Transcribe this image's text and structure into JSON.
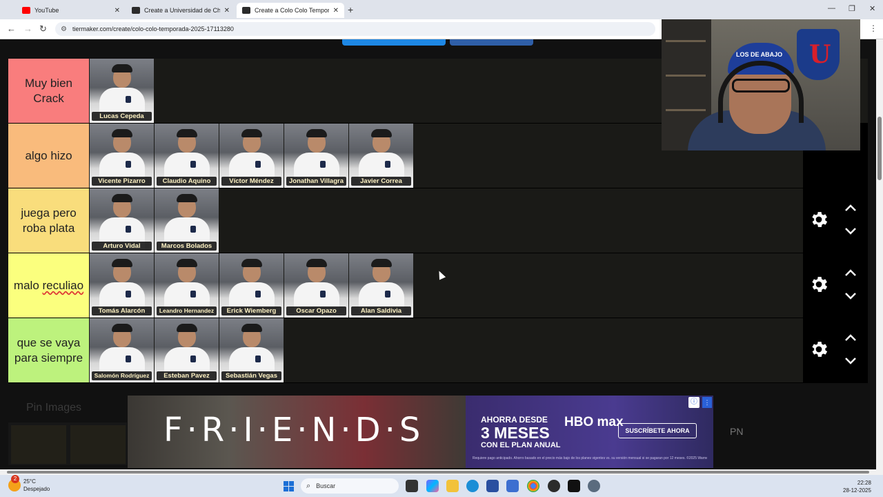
{
  "browser": {
    "tabs": [
      {
        "label": "YouTube",
        "favicon_color": "#ff0000",
        "active": false
      },
      {
        "label": "Create a Universidad de Chile T",
        "favicon_color": "#2b2b2b",
        "active": false
      },
      {
        "label": "Create a Colo Colo Temporada",
        "favicon_color": "#2b2b2b",
        "active": true
      }
    ],
    "new_tab": "+",
    "url": "tiermaker.com/create/colo-colo-temporada-2025-17113280"
  },
  "tiers": [
    {
      "label": "Muy bien Crack",
      "color": "#f97d7d",
      "players": [
        "Lucas Cepeda"
      ]
    },
    {
      "label": "algo hizo",
      "color": "#f9bb7c",
      "players": [
        "Vicente Pizarro",
        "Claudio Aquino",
        "Víctor Méndez",
        "Jonathan Villagra",
        "Javier Correa"
      ]
    },
    {
      "label": "juega pero roba plata",
      "color": "#f9dd7c",
      "players": [
        "Arturo Vidal",
        "Marcos Bolados"
      ]
    },
    {
      "label_prefix": "malo ",
      "label_flagged": "reculiao",
      "color": "#fbff7e",
      "players": [
        "Tomás Alarcón",
        "Leandro Hernandez",
        "Erick Wiemberg",
        "Oscar Opazo",
        "Alan Saldivia"
      ]
    },
    {
      "label": "que se vaya para siempre",
      "color": "#bdf27d",
      "players": [
        "Salomón Rodríguez",
        "Esteban Pavez",
        "Sebastián Vegas"
      ]
    }
  ],
  "webcam": {
    "cap_text": "LOS DE ABAJO",
    "crest_letter": "U"
  },
  "pin_images": {
    "label": "Pin Images"
  },
  "ad": {
    "friends": "F·R·I·E·N·D·S",
    "line1": "AHORRA DESDE",
    "line2": "3 MESES",
    "line3": "CON EL PLAN ANUAL",
    "brand": "HBO max",
    "cta": "SUSCRÍBETE AHORA",
    "fine_print": "Requiere pago anticipado. Ahorro basado en el precio más bajo de los planes vigentes vs. su versión mensual si se pagaran por 12 meses. ©2025 WarnerMedia Direct Latin America, LLC. Todos los derechos reservados. HBO Max es propiedad de Home Box Office, Inc."
  },
  "pn_label": "PN",
  "taskbar": {
    "weather_temp": "25°C",
    "weather_desc": "Despejado",
    "weather_badge": "2",
    "search_placeholder": "Buscar",
    "time": "22:28",
    "date": "28-12-2025"
  }
}
